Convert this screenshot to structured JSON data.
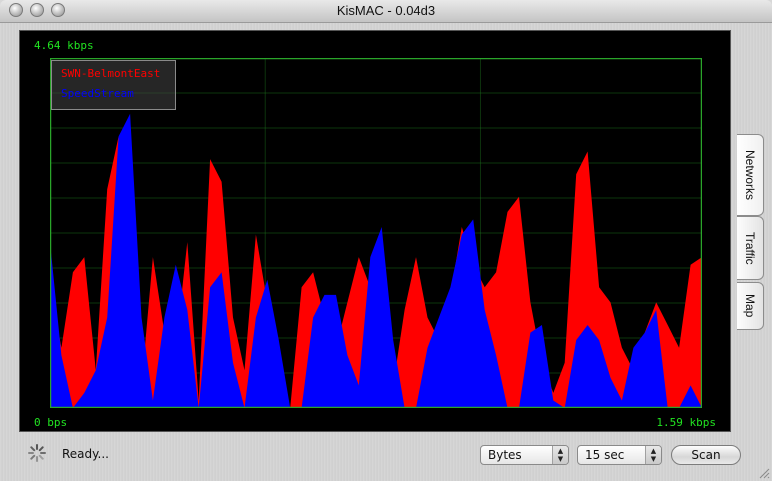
{
  "window": {
    "title": "KisMAC - 0.04d3"
  },
  "graph": {
    "max_label": "4.64 kbps",
    "min_label": "0 bps",
    "current_label": "1.59 kbps",
    "background": "#000000",
    "grid_color": "#1e7a1e",
    "label_color": "#21e321"
  },
  "legend": [
    {
      "name": "SWN-BelmontEast",
      "color": "#ff0000"
    },
    {
      "name": "SpeedStream",
      "color": "#0000ff"
    }
  ],
  "chart_data": {
    "type": "area",
    "ylim": [
      0,
      4.64
    ],
    "y_unit": "kbps",
    "grid": true,
    "legend_position": "top-left",
    "series": [
      {
        "name": "SWN-BelmontEast",
        "color": "#ff0000",
        "values": [
          1.6,
          0.8,
          1.8,
          2.0,
          0.5,
          2.9,
          3.6,
          1.1,
          0.3,
          2.0,
          1.0,
          0.8,
          2.2,
          0.1,
          3.3,
          3.0,
          1.2,
          0.5,
          2.3,
          1.4,
          0.0,
          0.0,
          1.6,
          1.8,
          1.2,
          0.8,
          1.4,
          2.0,
          1.6,
          0.6,
          0.3,
          1.3,
          2.0,
          1.2,
          0.9,
          1.5,
          2.4,
          1.9,
          1.6,
          1.8,
          2.6,
          2.8,
          1.4,
          0.6,
          0.2,
          0.6,
          3.1,
          3.4,
          1.6,
          1.4,
          0.8,
          0.5,
          1.0,
          1.4,
          1.1,
          0.8,
          1.9,
          2.0
        ]
      },
      {
        "name": "SpeedStream",
        "color": "#0000ff",
        "values": [
          2.2,
          0.7,
          0.0,
          0.2,
          0.5,
          1.2,
          3.6,
          3.9,
          1.2,
          0.1,
          1.2,
          1.9,
          1.3,
          0.0,
          1.6,
          1.8,
          0.6,
          0.0,
          1.2,
          1.7,
          0.9,
          0.0,
          0.0,
          1.2,
          1.5,
          1.5,
          0.7,
          0.3,
          2.0,
          2.4,
          0.9,
          0.0,
          0.0,
          0.8,
          1.2,
          1.6,
          2.3,
          2.5,
          1.3,
          0.7,
          0.0,
          0.0,
          1.0,
          1.1,
          0.1,
          0.0,
          0.9,
          1.1,
          0.9,
          0.4,
          0.1,
          0.8,
          1.0,
          1.3,
          0.0,
          0.0,
          0.3,
          0.0
        ]
      }
    ]
  },
  "tabs": [
    {
      "label": "Networks"
    },
    {
      "label": "Traffic"
    },
    {
      "label": "Map"
    }
  ],
  "status": {
    "text": "Ready..."
  },
  "controls": {
    "units": "Bytes",
    "interval": "15 sec",
    "scan_label": "Scan"
  }
}
